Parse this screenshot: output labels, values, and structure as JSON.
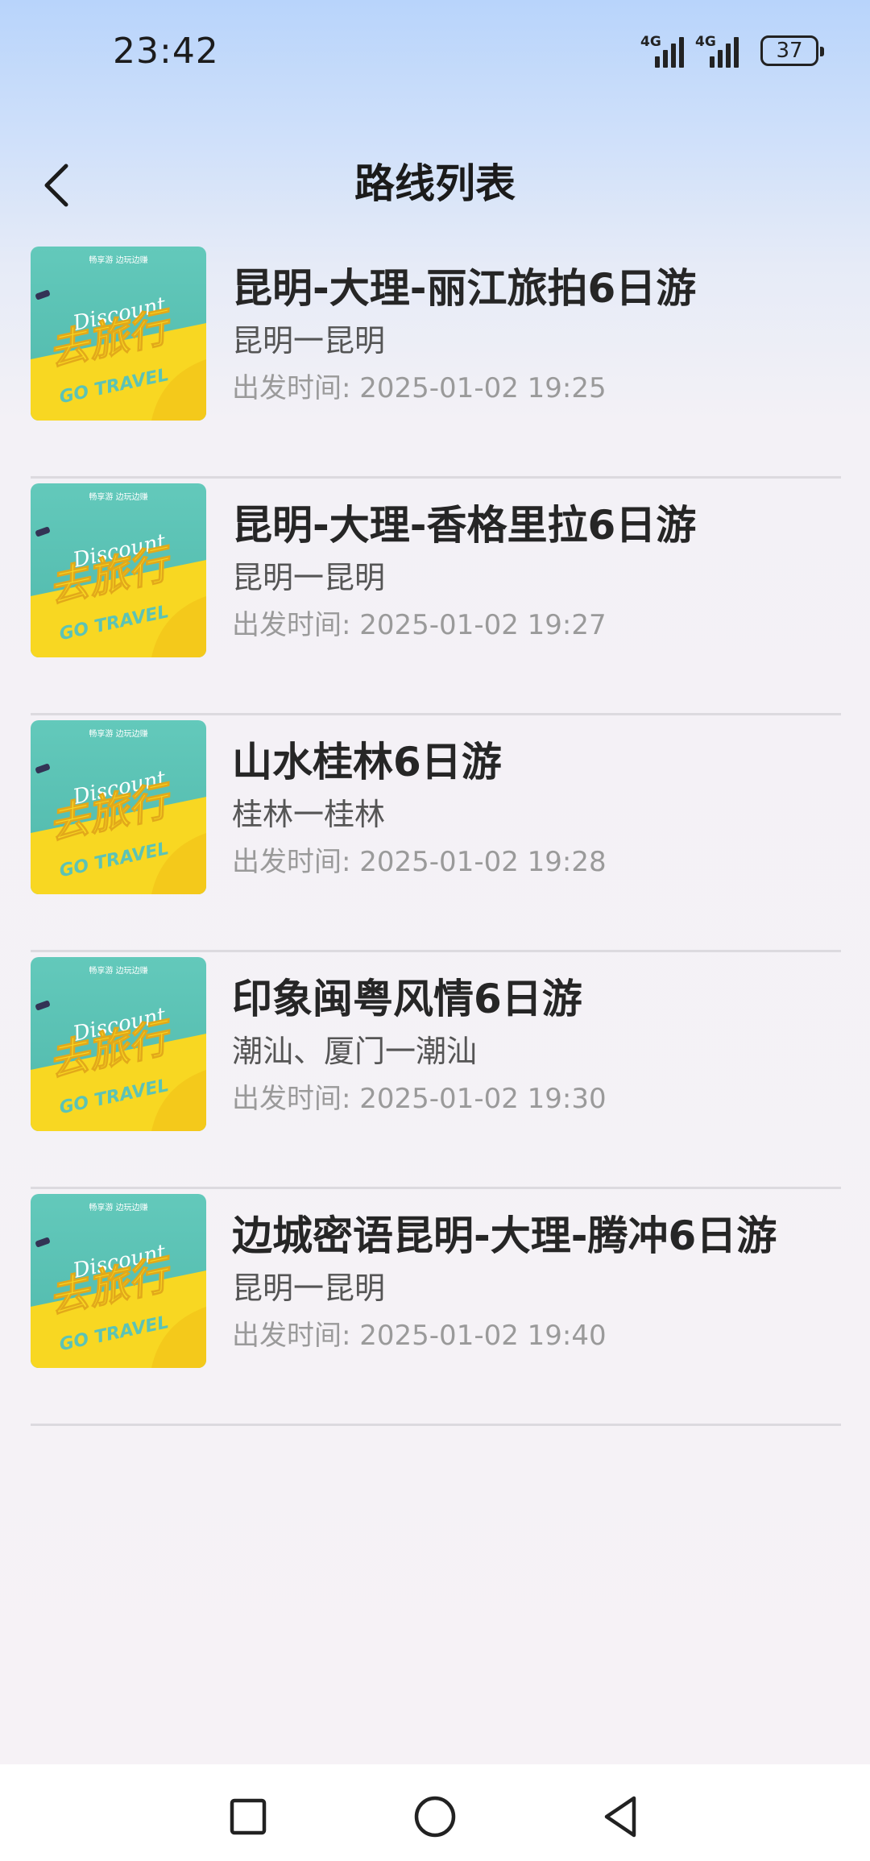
{
  "status_bar": {
    "time": "23:42",
    "network1": "4G",
    "network2": "4G",
    "battery": "37"
  },
  "header": {
    "title": "路线列表",
    "back_icon": "chevron-left-icon"
  },
  "thumbnail": {
    "top_text": "畅享游 边玩边赚",
    "script_text": "Discount",
    "main_text": "去旅行",
    "sub_text": "GO TRAVEL",
    "colors": {
      "teal": "#5fc6b8",
      "yellow": "#f7d623"
    }
  },
  "routes": [
    {
      "title": "昆明-大理-丽江旅拍6日游",
      "route": "昆明一昆明",
      "time": "出发时间:  2025-01-02 19:25"
    },
    {
      "title": "昆明-大理-香格里拉6日游",
      "route": "昆明一昆明",
      "time": "出发时间:  2025-01-02 19:27"
    },
    {
      "title": "山水桂林6日游",
      "route": "桂林一桂林",
      "time": "出发时间:  2025-01-02 19:28"
    },
    {
      "title": "印象闽粤风情6日游",
      "route": "潮汕、厦门一潮汕",
      "time": "出发时间:  2025-01-02 19:30"
    },
    {
      "title": "边城密语昆明-大理-腾冲6日游",
      "route": "昆明一昆明",
      "time": "出发时间:  2025-01-02 19:40"
    }
  ],
  "nav": {
    "recent_icon": "square-icon",
    "home_icon": "circle-icon",
    "back_icon": "triangle-back-icon"
  }
}
